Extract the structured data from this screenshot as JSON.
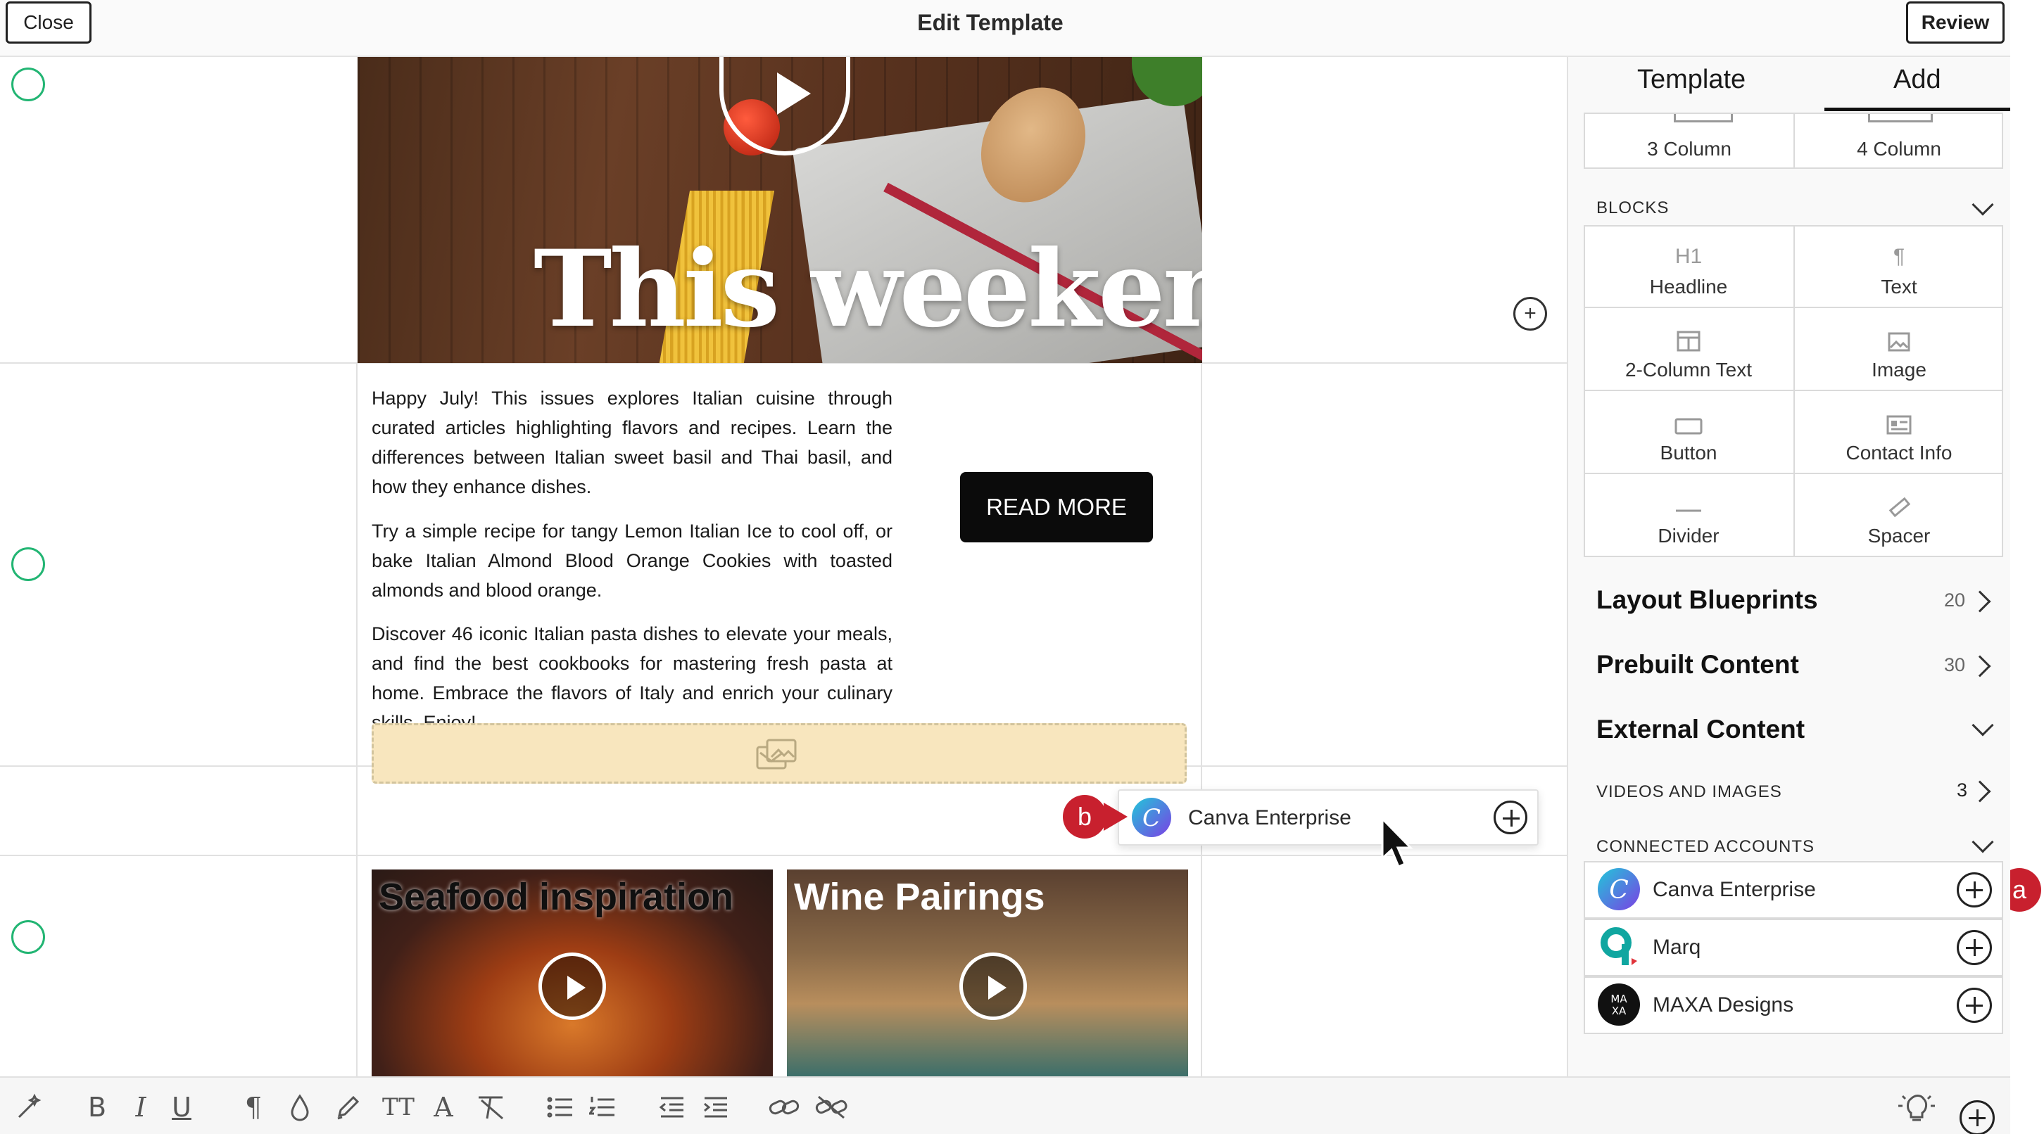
{
  "header": {
    "close_label": "Close",
    "title": "Edit Template",
    "review_label": "Review"
  },
  "hero": {
    "title": "This weekend"
  },
  "article": {
    "paragraphs": [
      "Happy July! This issues explores Italian cuisine through curated articles highlighting flavors and recipes. Learn the differences between Italian sweet basil and Thai basil, and how they enhance dishes.",
      "Try a simple recipe for tangy Lemon Italian Ice to cool off, or bake Italian Almond Blood Orange Cookies with toasted almonds and blood orange.",
      "Discover 46 iconic Italian pasta dishes to elevate your meals, and find the best cookbooks for mastering fresh pasta at home. Embrace the flavors of Italy and enrich your culinary skills. Enjoy!"
    ],
    "button_label": "READ MORE"
  },
  "drag_chip": {
    "label": "Canva Enterprise"
  },
  "callouts": {
    "a": "a",
    "b": "b"
  },
  "cards": [
    {
      "title": "Seafood inspiration"
    },
    {
      "title": "Wine Pairings"
    }
  ],
  "panel": {
    "tabs": [
      "Template",
      "Add"
    ],
    "active_tab": "Add",
    "columns": [
      "3 Column",
      "4 Column"
    ],
    "blocks_label": "Blocks",
    "blocks": [
      {
        "label": "Headline",
        "icon": "h1-icon",
        "glyph": "H1"
      },
      {
        "label": "Text",
        "icon": "paragraph-icon",
        "glyph": "¶"
      },
      {
        "label": "2-Column Text",
        "icon": "two-column-icon"
      },
      {
        "label": "Image",
        "icon": "image-icon"
      },
      {
        "label": "Button",
        "icon": "button-icon"
      },
      {
        "label": "Contact Info",
        "icon": "contact-card-icon"
      },
      {
        "label": "Divider",
        "icon": "divider-icon"
      },
      {
        "label": "Spacer",
        "icon": "ruler-icon"
      }
    ],
    "layout_blueprints": {
      "label": "Layout Blueprints",
      "count": "20"
    },
    "prebuilt_content": {
      "label": "Prebuilt Content",
      "count": "30"
    },
    "external_content": {
      "label": "External Content"
    },
    "videos_images": {
      "label": "Videos and Images",
      "count": "3"
    },
    "connected_accounts": {
      "label": "Connected Accounts",
      "items": [
        {
          "name": "Canva Enterprise",
          "logo_color": "#1fb6d4"
        },
        {
          "name": "Marq",
          "logo_color": "#10a6a0"
        },
        {
          "name": "MAXA Designs",
          "logo_color": "#111111",
          "logo_text": "MA XA"
        }
      ]
    }
  },
  "toolbar": {
    "bold": "B",
    "italic": "I",
    "underline": "U",
    "paragraph": "¶",
    "text_size": "TT",
    "font": "A"
  },
  "colors": {
    "accent_green": "#22b573",
    "callout_red": "#c8202e",
    "button_black": "#0b0b0b",
    "placeholder_yellow": "#f8e6be"
  }
}
